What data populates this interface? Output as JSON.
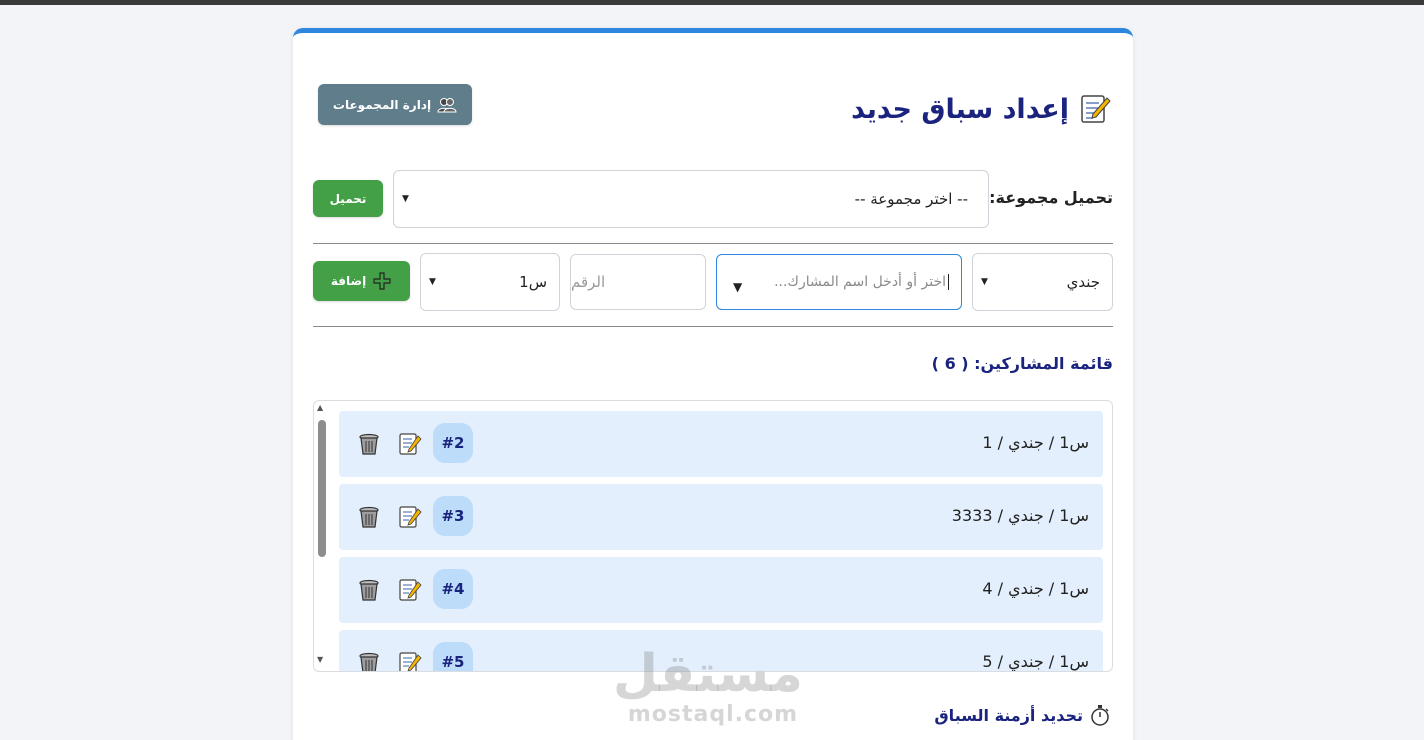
{
  "header": {
    "title": "إعداد سباق جديد",
    "title_icon": "memo-icon",
    "groups_button": "إدارة المجموعات",
    "groups_icon": "users-icon"
  },
  "load_group": {
    "label": "تحميل مجموعة:",
    "selected": "-- اختر مجموعة --",
    "load_button": "تحميل"
  },
  "add_participant": {
    "rank_value": "جندي",
    "name_placeholder": "اختر أو أدخل اسم المشارك...",
    "number_placeholder": "الرقم",
    "class_value": "س1",
    "add_button": "إضافة",
    "add_icon": "plus-icon"
  },
  "participants": {
    "title": "قائمة المشاركين: ( 6 )",
    "items": [
      {
        "text": "س1 / جندي / 1",
        "badge": "#2"
      },
      {
        "text": "س1 / جندي / 3333",
        "badge": "#3"
      },
      {
        "text": "س1 / جندي / 4",
        "badge": "#4"
      },
      {
        "text": "س1 / جندي / 5",
        "badge": "#5"
      }
    ]
  },
  "timing": {
    "title": "تحديد أزمنة السباق",
    "icon": "stopwatch-icon"
  },
  "watermark": {
    "arabic": "مستقل",
    "latin": "mostaql.com"
  }
}
